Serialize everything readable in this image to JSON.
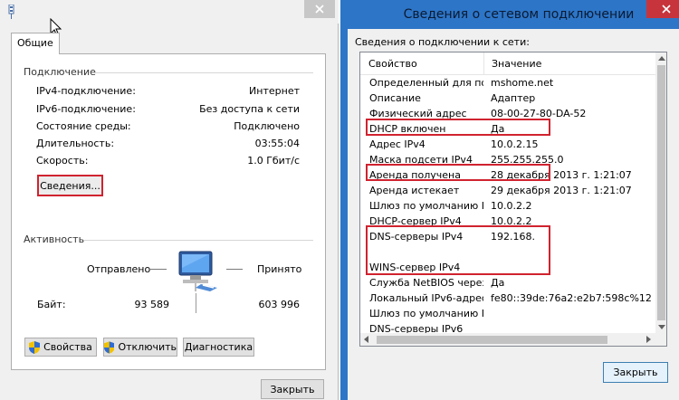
{
  "status_window": {
    "tab_label": "Общие",
    "connection": {
      "heading": "Подключение",
      "rows": [
        {
          "label": "IPv4-подключение:",
          "value": "Интернет"
        },
        {
          "label": "IPv6-подключение:",
          "value": "Без доступа к сети"
        },
        {
          "label": "Состояние среды:",
          "value": "Подключено"
        },
        {
          "label": "Длительность:",
          "value": "03:55:04"
        },
        {
          "label": "Скорость:",
          "value": "1.0 Гбит/с"
        }
      ],
      "details_button": "Сведения..."
    },
    "activity": {
      "heading": "Активность",
      "sent_label": "Отправлено",
      "received_label": "Принято",
      "bytes_label": "Байт:",
      "bytes_sent": "93 589",
      "bytes_received": "603 996"
    },
    "buttons": {
      "properties": "Свойства",
      "disable": "Отключить",
      "diagnostics": "Диагностика"
    },
    "close_button": "Закрыть"
  },
  "details_window": {
    "title": "Сведения о сетевом подключении",
    "caption": "Сведения о подключении к сети:",
    "columns": {
      "property": "Свойство",
      "value": "Значение"
    },
    "rows": [
      {
        "property": "Определенный для по...",
        "value": "mshome.net"
      },
      {
        "property": "Описание",
        "value": "Адаптер"
      },
      {
        "property": "Физический адрес",
        "value": "08-00-27-80-DA-52"
      },
      {
        "property": "DHCP включен",
        "value": "Да"
      },
      {
        "property": "Адрес IPv4",
        "value": "10.0.2.15"
      },
      {
        "property": "Маска подсети IPv4",
        "value": "255.255.255.0"
      },
      {
        "property": "Аренда получена",
        "value": "28 декабря 2013 г. 1:21:07"
      },
      {
        "property": "Аренда истекает",
        "value": "29 декабря 2013 г. 1:21:07"
      },
      {
        "property": "Шлюз по умолчанию IP...",
        "value": "10.0.2.2"
      },
      {
        "property": "DHCP-сервер IPv4",
        "value": "10.0.2.2"
      },
      {
        "property": "DNS-серверы IPv4",
        "value": "192.168."
      },
      {
        "property": "",
        "value": ""
      },
      {
        "property": "WINS-сервер IPv4",
        "value": ""
      },
      {
        "property": "Служба NetBIOS через...",
        "value": "Да"
      },
      {
        "property": "Локальный IPv6-адрес...",
        "value": "fe80::39de:76a2:e2b7:598c%12"
      },
      {
        "property": "Шлюз по умолчанию IP...",
        "value": ""
      },
      {
        "property": "DNS-серверы IPv6",
        "value": ""
      }
    ],
    "close_button": "Закрыть"
  },
  "colors": {
    "highlight_red": "#d0232f",
    "title_blue": "#2d75c7",
    "close_red": "#c7343b"
  }
}
